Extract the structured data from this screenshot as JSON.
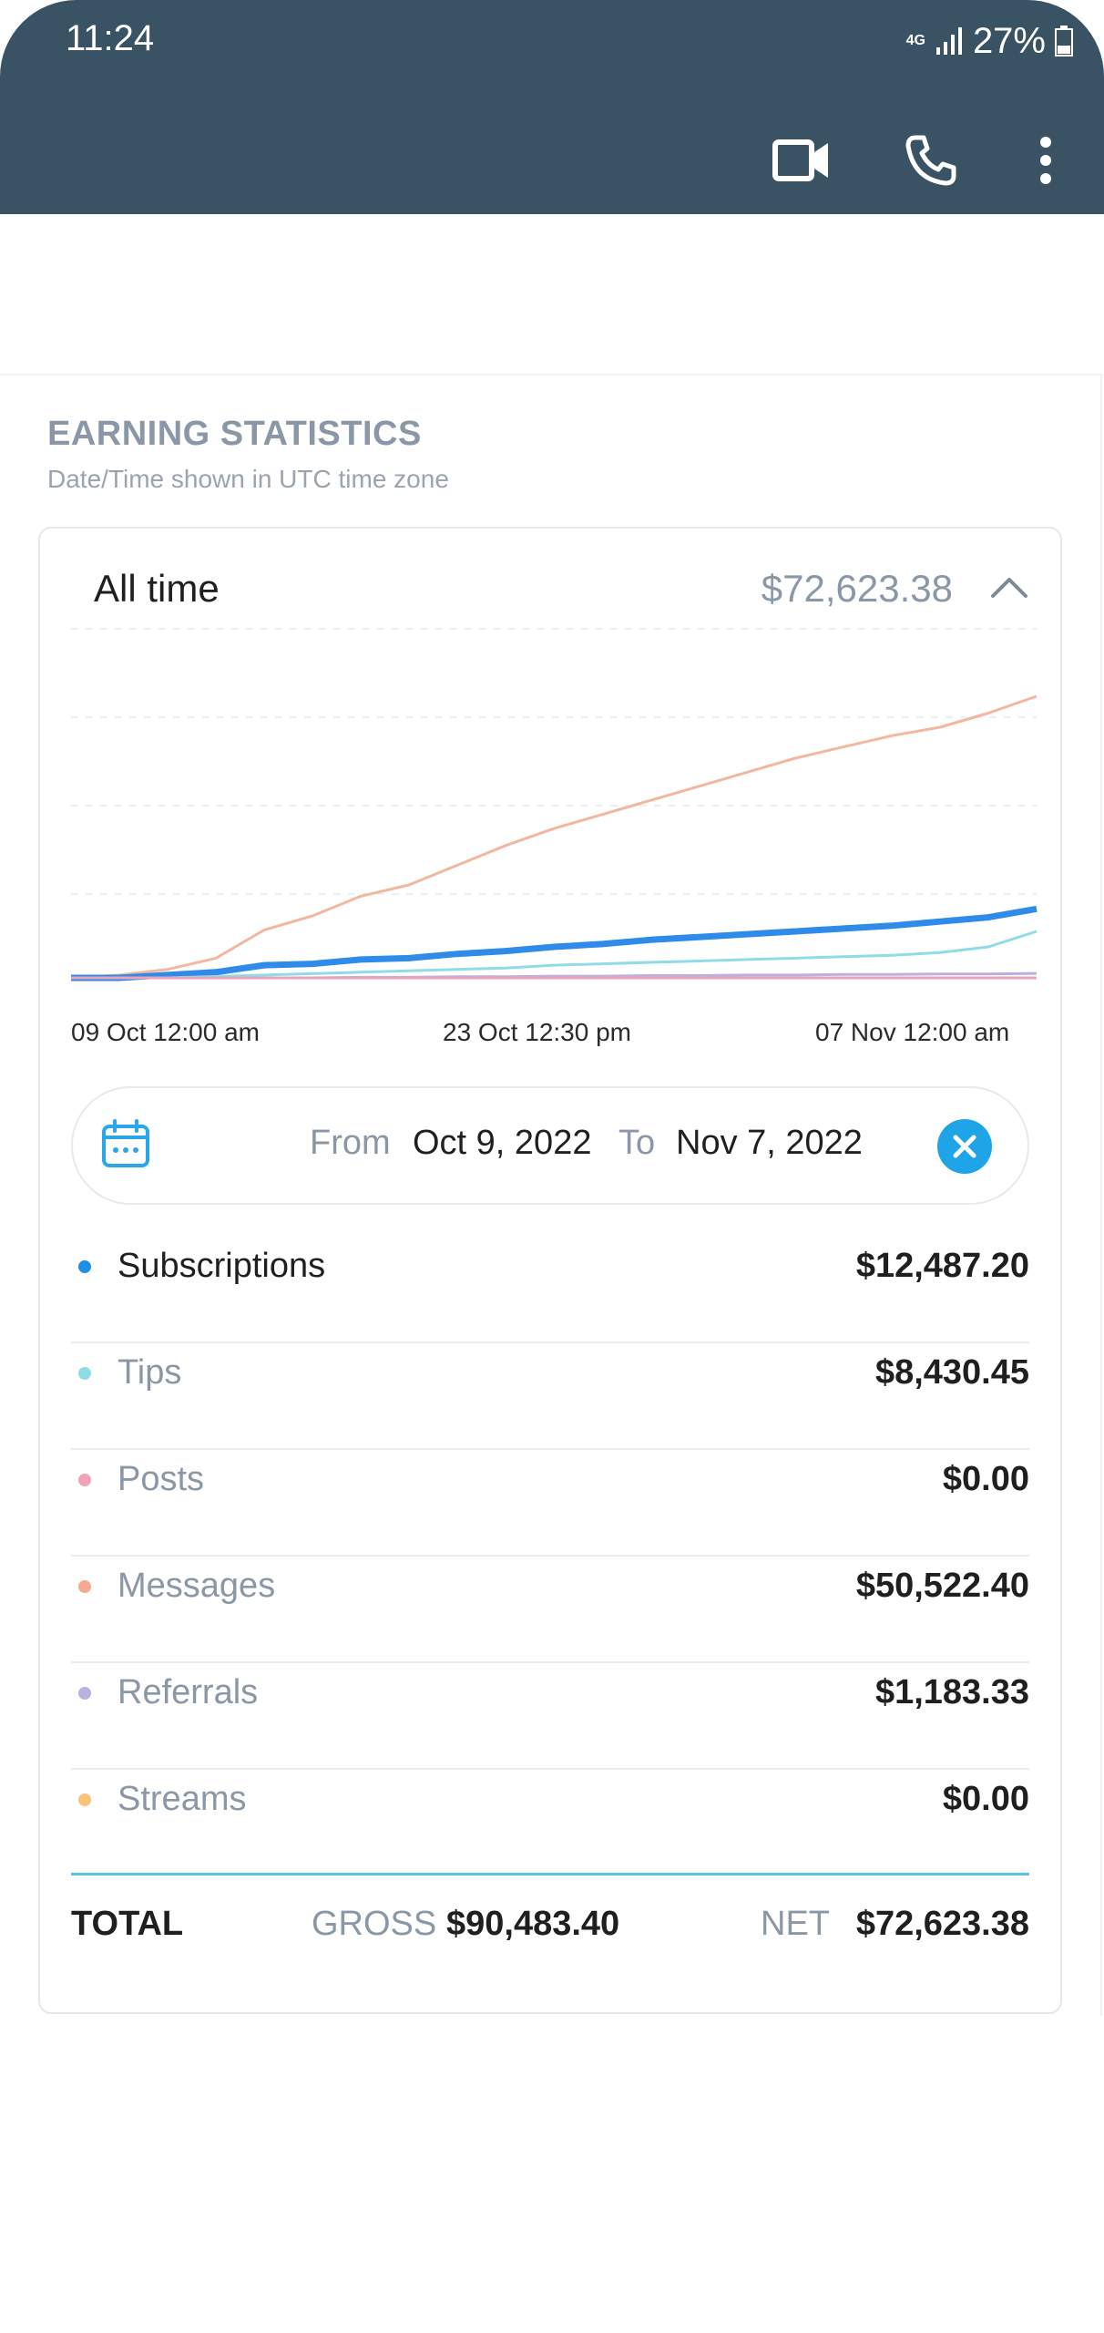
{
  "status_bar": {
    "time": "11:24",
    "network": "4G",
    "battery": "27%"
  },
  "app_bar": {
    "icons": [
      "video-call-icon",
      "phone-icon",
      "more-vert-icon"
    ],
    "color": "#3a5364"
  },
  "section": {
    "title": "EARNING STATISTICS",
    "subtitle": "Date/Time shown in UTC time zone"
  },
  "card": {
    "period": "All time",
    "period_total": "$72,623.38",
    "toggle_icon": "chevron-up-icon"
  },
  "chart_data": {
    "type": "line",
    "x_ticks": [
      "09 Oct 12:00 am",
      "23 Oct 12:30 pm",
      "07 Nov 12:00 am"
    ],
    "x": [
      0,
      0.05,
      0.1,
      0.15,
      0.2,
      0.25,
      0.3,
      0.35,
      0.4,
      0.45,
      0.5,
      0.55,
      0.6,
      0.65,
      0.7,
      0.75,
      0.8,
      0.85,
      0.9,
      0.95,
      1.0
    ],
    "grid": true,
    "series": [
      {
        "name": "Messages",
        "color": "#f3b6a0",
        "values": [
          0,
          0.01,
          0.03,
          0.07,
          0.17,
          0.22,
          0.29,
          0.33,
          0.4,
          0.47,
          0.53,
          0.58,
          0.63,
          0.68,
          0.73,
          0.78,
          0.82,
          0.86,
          0.89,
          0.94,
          1.0
        ]
      },
      {
        "name": "Subscriptions",
        "color": "#2f8bea",
        "values": [
          0,
          0.0,
          0.01,
          0.02,
          0.045,
          0.05,
          0.065,
          0.07,
          0.085,
          0.095,
          0.11,
          0.12,
          0.135,
          0.145,
          0.155,
          0.165,
          0.175,
          0.185,
          0.2,
          0.215,
          0.245
        ]
      },
      {
        "name": "Tips",
        "color": "#8fdbe6",
        "values": [
          0,
          0.0,
          0.0,
          0.005,
          0.01,
          0.015,
          0.02,
          0.025,
          0.03,
          0.035,
          0.045,
          0.05,
          0.055,
          0.06,
          0.065,
          0.07,
          0.075,
          0.08,
          0.09,
          0.11,
          0.165
        ]
      },
      {
        "name": "Referrals",
        "color": "#b9b1e0",
        "values": [
          0,
          0,
          0,
          0,
          0,
          0,
          0.002,
          0.002,
          0.004,
          0.004,
          0.006,
          0.006,
          0.008,
          0.008,
          0.01,
          0.01,
          0.012,
          0.012,
          0.014,
          0.014,
          0.016
        ]
      },
      {
        "name": "Posts",
        "color": "#f0a3b8",
        "values": [
          0,
          0,
          0,
          0,
          0,
          0,
          0,
          0,
          0,
          0,
          0,
          0,
          0,
          0,
          0,
          0,
          0,
          0,
          0,
          0,
          0
        ]
      }
    ]
  },
  "date_range": {
    "from_label": "From",
    "from": "Oct 9, 2022",
    "to_label": "To",
    "to": "Nov 7, 2022"
  },
  "rows": [
    {
      "label": "Subscriptions",
      "value": "$12,487.20",
      "dot": "#1f8fe6",
      "label_color": "#1f1f1f"
    },
    {
      "label": "Tips",
      "value": "$8,430.45",
      "dot": "#8fdbe6",
      "label_color": "#8a97a6"
    },
    {
      "label": "Posts",
      "value": "$0.00",
      "dot": "#f0a3b8",
      "label_color": "#8a97a6"
    },
    {
      "label": "Messages",
      "value": "$50,522.40",
      "dot": "#f4a990",
      "label_color": "#8a97a6"
    },
    {
      "label": "Referrals",
      "value": "$1,183.33",
      "dot": "#b9b1e0",
      "label_color": "#8a97a6"
    },
    {
      "label": "Streams",
      "value": "$0.00",
      "dot": "#f7c57a",
      "label_color": "#8a97a6"
    }
  ],
  "totals": {
    "label": "TOTAL",
    "gross_label": "GROSS",
    "gross": "$90,483.40",
    "net_label": "NET",
    "net": "$72,623.38"
  }
}
